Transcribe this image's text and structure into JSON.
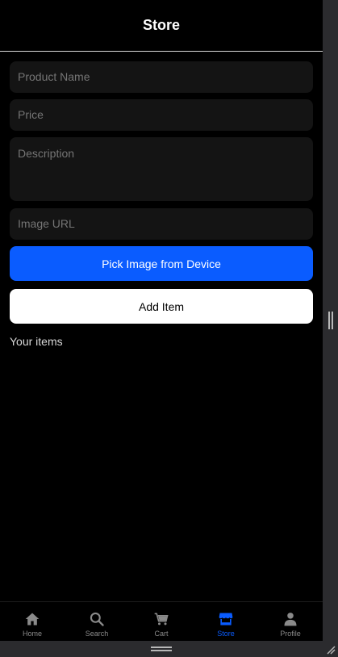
{
  "header": {
    "title": "Store"
  },
  "form": {
    "product_name": {
      "placeholder": "Product Name",
      "value": ""
    },
    "price": {
      "placeholder": "Price",
      "value": ""
    },
    "description": {
      "placeholder": "Description",
      "value": ""
    },
    "image_url": {
      "placeholder": "Image URL",
      "value": ""
    },
    "pick_image_label": "Pick Image from Device",
    "add_item_label": "Add Item"
  },
  "items_section": {
    "label": "Your items"
  },
  "tabs": [
    {
      "label": "Home",
      "icon": "home-icon",
      "active": false
    },
    {
      "label": "Search",
      "icon": "search-icon",
      "active": false
    },
    {
      "label": "Cart",
      "icon": "cart-icon",
      "active": false
    },
    {
      "label": "Store",
      "icon": "store-icon",
      "active": true
    },
    {
      "label": "Profile",
      "icon": "profile-icon",
      "active": false
    }
  ],
  "colors": {
    "accent": "#0a5cff",
    "background": "#000000",
    "field": "#141414",
    "inactive_tab": "#8a8a8a"
  }
}
